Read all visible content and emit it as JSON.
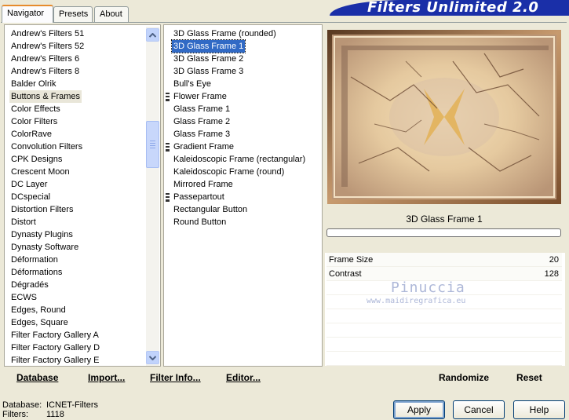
{
  "tabs": [
    {
      "label": "Navigator",
      "active": true
    },
    {
      "label": "Presets",
      "active": false
    },
    {
      "label": "About",
      "active": false
    }
  ],
  "app_title": "Filters Unlimited 2.0",
  "categories": [
    {
      "label": "Andrew's Filters 51"
    },
    {
      "label": "Andrew's Filters 52"
    },
    {
      "label": "Andrew's Filters 6"
    },
    {
      "label": "Andrew's Filters 8"
    },
    {
      "label": "Balder Olrik"
    },
    {
      "label": "Buttons & Frames",
      "selected": true
    },
    {
      "label": "Color Effects"
    },
    {
      "label": "Color Filters"
    },
    {
      "label": "ColorRave"
    },
    {
      "label": "Convolution Filters"
    },
    {
      "label": "CPK Designs"
    },
    {
      "label": "Crescent Moon"
    },
    {
      "label": "DC Layer"
    },
    {
      "label": "DCspecial"
    },
    {
      "label": "Distortion Filters"
    },
    {
      "label": "Distort"
    },
    {
      "label": "Dynasty Plugins"
    },
    {
      "label": "Dynasty Software"
    },
    {
      "label": "Déformation"
    },
    {
      "label": "Déformations"
    },
    {
      "label": "Dégradés"
    },
    {
      "label": "ECWS"
    },
    {
      "label": "Edges, Round"
    },
    {
      "label": "Edges, Square"
    },
    {
      "label": "Filter Factory Gallery A"
    },
    {
      "label": "Filter Factory Gallery D"
    },
    {
      "label": "Filter Factory Gallery E"
    }
  ],
  "filters": [
    {
      "label": "3D Glass Frame (rounded)"
    },
    {
      "label": "3D Glass Frame 1",
      "selected": true
    },
    {
      "label": "3D Glass Frame 2"
    },
    {
      "label": "3D Glass Frame 3"
    },
    {
      "label": "Bull's Eye"
    },
    {
      "label": "Flower Frame",
      "group": true
    },
    {
      "label": "Glass Frame 1"
    },
    {
      "label": "Glass Frame 2"
    },
    {
      "label": "Glass Frame 3"
    },
    {
      "label": "Gradient Frame",
      "group": true
    },
    {
      "label": "Kaleidoscopic Frame (rectangular)"
    },
    {
      "label": "Kaleidoscopic Frame (round)"
    },
    {
      "label": "Mirrored Frame"
    },
    {
      "label": "Passepartout",
      "group": true
    },
    {
      "label": "Rectangular Button"
    },
    {
      "label": "Round Button"
    }
  ],
  "left_links": {
    "database": "Database",
    "import": "Import...",
    "filter_info": "Filter Info...",
    "editor": "Editor..."
  },
  "preview": {
    "filter_name": "3D Glass Frame 1",
    "progress": 0
  },
  "params": [
    {
      "label": "Frame Size",
      "value": "20"
    },
    {
      "label": "Contrast",
      "value": "128"
    }
  ],
  "watermark": {
    "name": "Pinuccia",
    "url": "www.maidiregrafica.eu"
  },
  "right_links": {
    "randomize": "Randomize",
    "reset": "Reset"
  },
  "status": {
    "database_label": "Database:",
    "database_value": "ICNET-Filters",
    "filters_label": "Filters:",
    "filters_value": "1118"
  },
  "buttons": {
    "apply": "Apply",
    "cancel": "Cancel",
    "help": "Help"
  },
  "colors": {
    "banner": "#1a2fa8",
    "selection": "#316ac5",
    "dialog_bg": "#ece9d8"
  }
}
